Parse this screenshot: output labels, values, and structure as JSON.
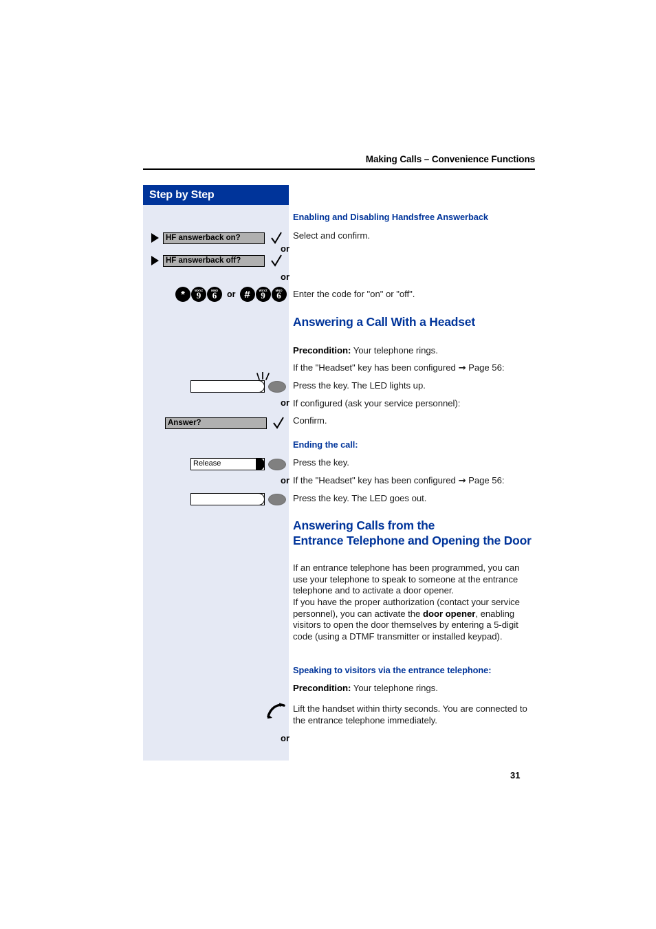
{
  "header": {
    "running_head": "Making Calls – Convenience Functions"
  },
  "sidebar": {
    "title": "Step by Step",
    "items": [
      {
        "type": "display-option",
        "label": "HF answerback on?",
        "bullet": true,
        "confirm": true
      },
      {
        "type": "or",
        "label": "or"
      },
      {
        "type": "display-option",
        "label": "HF answerback off?",
        "bullet": true,
        "confirm": true
      },
      {
        "type": "or",
        "label": "or"
      },
      {
        "type": "keypad",
        "sequence_1": [
          "*",
          "9",
          "6"
        ],
        "joiner": "or",
        "sequence_2": [
          "#",
          "9",
          "6"
        ],
        "key_sublabels": {
          "9": "WXYZ",
          "6": "MNO"
        }
      },
      {
        "type": "function-key",
        "label": "",
        "led_lit": true
      },
      {
        "type": "or",
        "label": "or"
      },
      {
        "type": "display-option",
        "label": "Answer?",
        "bullet": false,
        "confirm": true
      },
      {
        "type": "function-key",
        "label": "Release",
        "led_lit": false
      },
      {
        "type": "or",
        "label": "or"
      },
      {
        "type": "function-key",
        "label": "",
        "led_lit": false
      },
      {
        "type": "handset",
        "icon": "lift-handset-icon"
      },
      {
        "type": "or",
        "label": "or"
      }
    ]
  },
  "content": {
    "section_1_heading": "Enabling and Disabling Handsfree Answerback",
    "section_1_line_1": "Select and confirm.",
    "section_1_line_2": "Enter the code for \"on\" or \"off\".",
    "section_2_title": "Answering a Call With a Headset",
    "section_2_precondition_label": "Precondition:",
    "section_2_precondition_text": " Your telephone rings.",
    "section_2_line_1a": "If the \"Headset\" key has been configured ",
    "section_2_line_1_arrow": "→",
    "section_2_line_1b": " Page 56:",
    "section_2_line_2": "Press the key. The LED lights up.",
    "section_2_line_3": "If configured (ask your service personnel):",
    "section_2_line_4": "Confirm.",
    "section_3_heading": "Ending the call:",
    "section_3_line_1": "Press the key.",
    "section_3_line_2a": "If the \"Headset\" key has been configured ",
    "section_3_line_2_arrow": "→",
    "section_3_line_2b": " Page 56:",
    "section_3_line_3": "Press the key. The LED goes out.",
    "section_4_title_line_1": "Answering Calls from the",
    "section_4_title_line_2": "Entrance Telephone and Opening the Door",
    "section_4_para_1": "If an entrance telephone has been programmed, you can use your telephone to speak to someone at the entrance telephone and to activate a door opener.",
    "section_4_para_2a": "If you have the proper authorization (contact your service personnel), you can activate the ",
    "section_4_para_2_bold": "door opener",
    "section_4_para_2b": ", enabling visitors to open the door themselves by entering a 5-digit code (using a DTMF transmitter or installed keypad).",
    "section_5_heading": "Speaking to visitors via the entrance telephone:",
    "section_5_precondition_label": "Precondition:",
    "section_5_precondition_text": " Your telephone rings.",
    "section_5_line_1": "Lift the handset within thirty seconds. You are connected to the entrance telephone immediately."
  },
  "footer": {
    "page_number": "31"
  },
  "colors": {
    "brand_blue": "#00349a",
    "sidebar_bg": "#e5e9f4",
    "display_gray": "#b0b0b0",
    "led_gray": "#808080"
  }
}
